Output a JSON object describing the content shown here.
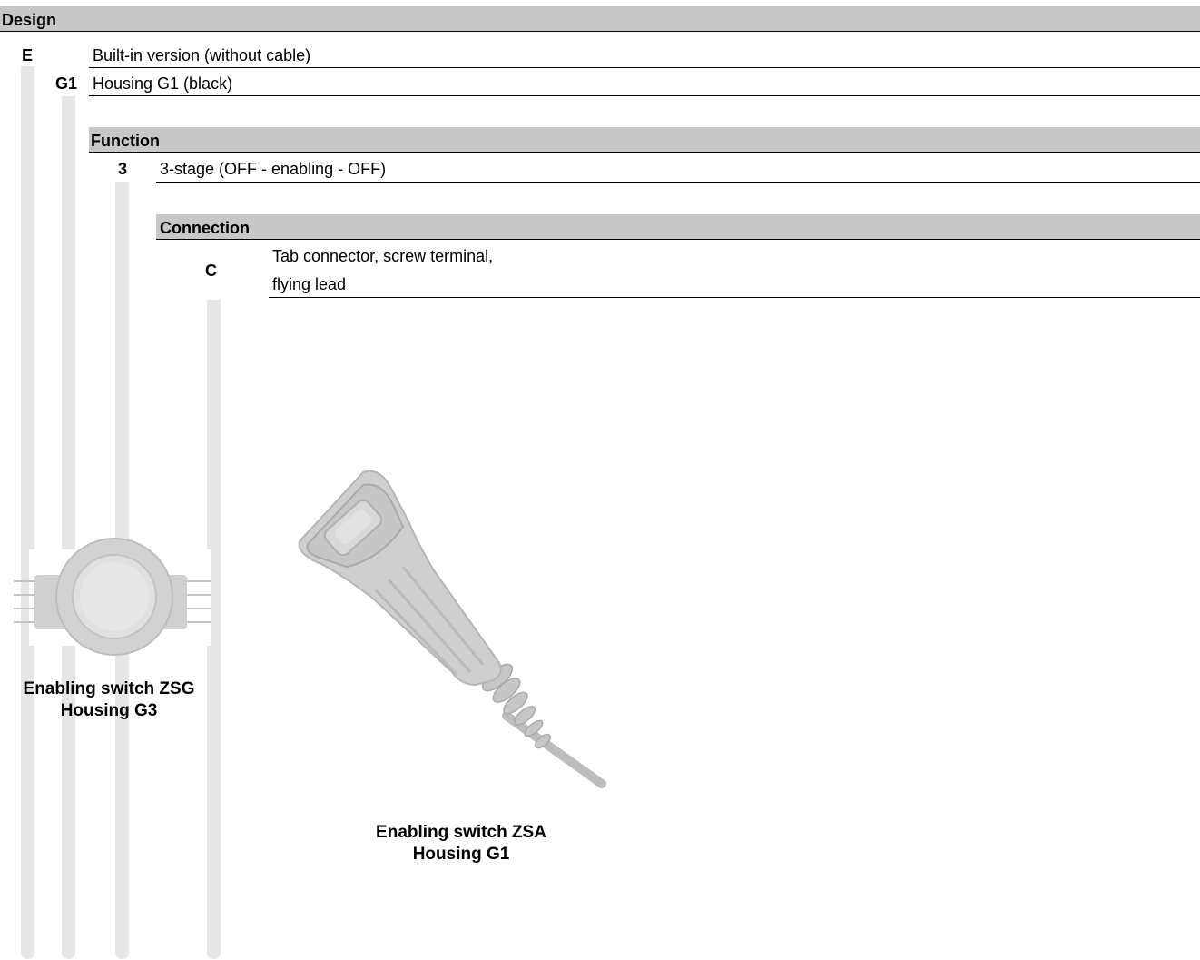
{
  "sections": {
    "design": {
      "heading": "Design",
      "rows": [
        {
          "code": "E",
          "text": "Built-in version (without cable)"
        },
        {
          "code": "G1",
          "text": "Housing G1 (black)"
        }
      ]
    },
    "function": {
      "heading": "Function",
      "rows": [
        {
          "code": "3",
          "text": "3-stage (OFF - enabling - OFF)"
        }
      ]
    },
    "connection": {
      "heading": "Connection",
      "rows": [
        {
          "code": "C",
          "line1": "Tab connector, screw terminal,",
          "line2": "flying lead"
        }
      ]
    }
  },
  "images": {
    "zsg": {
      "caption_line1": "Enabling switch ZSG",
      "caption_line2": "Housing G3",
      "icon": "switch-zsg-icon"
    },
    "zsa": {
      "caption_line1": "Enabling switch ZSA",
      "caption_line2": "Housing G1",
      "icon": "switch-zsa-icon"
    }
  },
  "colors": {
    "header_band": "#c8c8c8",
    "stripe": "#e6e6e6",
    "text": "#000000"
  }
}
